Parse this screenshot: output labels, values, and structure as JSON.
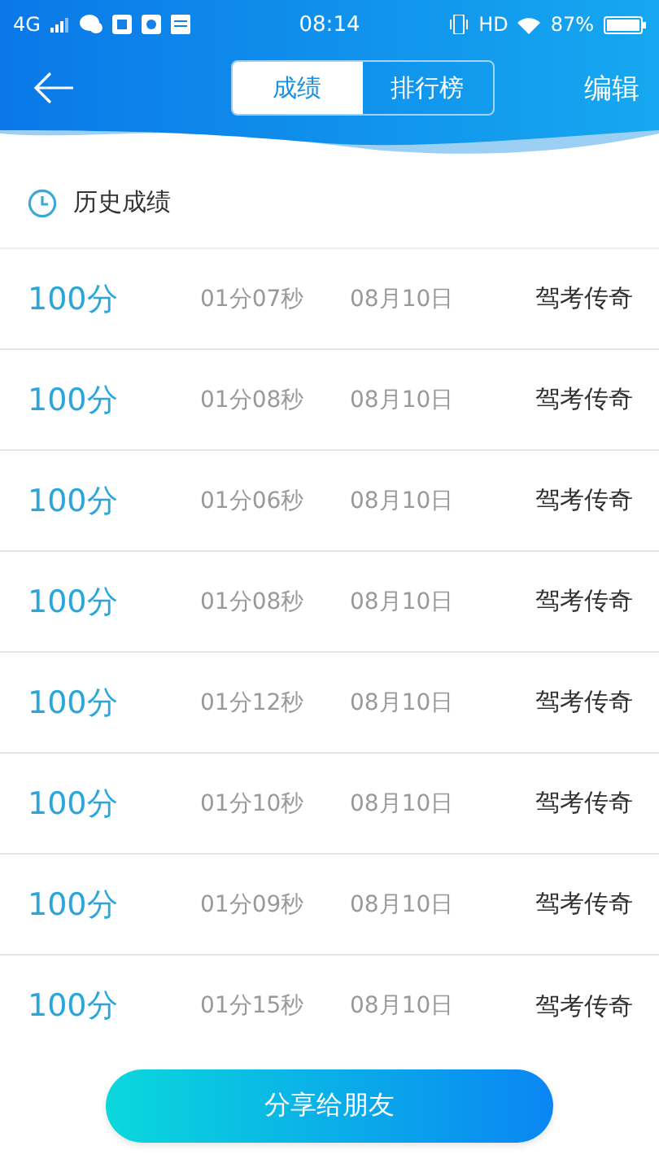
{
  "status_bar": {
    "network": "4G",
    "time": "08:14",
    "hd": "HD",
    "battery": "87%"
  },
  "header": {
    "tabs": [
      {
        "label": "成绩",
        "selected": true
      },
      {
        "label": "排行榜",
        "selected": false
      }
    ],
    "action": "编辑"
  },
  "section_title": "历史成绩",
  "rows": [
    {
      "score": "100分",
      "duration": "01分07秒",
      "date": "08月10日",
      "name": "驾考传奇"
    },
    {
      "score": "100分",
      "duration": "01分08秒",
      "date": "08月10日",
      "name": "驾考传奇"
    },
    {
      "score": "100分",
      "duration": "01分06秒",
      "date": "08月10日",
      "name": "驾考传奇"
    },
    {
      "score": "100分",
      "duration": "01分08秒",
      "date": "08月10日",
      "name": "驾考传奇"
    },
    {
      "score": "100分",
      "duration": "01分12秒",
      "date": "08月10日",
      "name": "驾考传奇"
    },
    {
      "score": "100分",
      "duration": "01分10秒",
      "date": "08月10日",
      "name": "驾考传奇"
    },
    {
      "score": "100分",
      "duration": "01分09秒",
      "date": "08月10日",
      "name": "驾考传奇"
    },
    {
      "score": "100分",
      "duration": "01分15秒",
      "date": "08月10日",
      "name": "驾考传奇"
    }
  ],
  "share_button": "分享给朋友"
}
